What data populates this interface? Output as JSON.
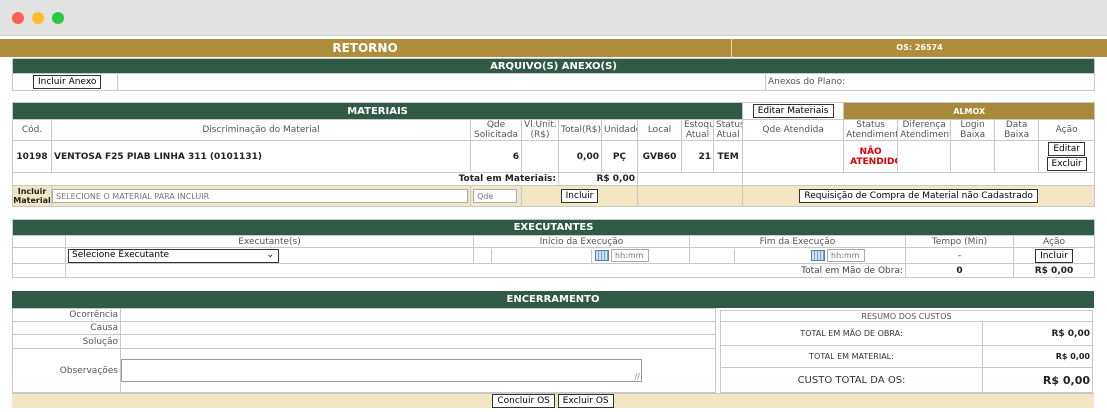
{
  "header": {
    "title": "RETORNO",
    "os": "OS: 26574"
  },
  "anexos": {
    "title": "ARQUIVO(S) ANEXO(S)",
    "add_button": "Incluir Anexo",
    "plan_label": "Anexos do Plano:"
  },
  "materiais": {
    "title": "MATERIAIS",
    "edit_button": "Editar Materiais",
    "almox_title": "ALMOX",
    "columns": [
      "Cód.",
      "Discriminação do Material",
      "Qde Solicitada",
      "Vl.Unit. (R$)",
      "Total(R$)",
      "Unidade",
      "Local",
      "Estoque Atual",
      "Status Atual",
      "Qde Atendida",
      "Status Atendimento",
      "Diferença Atendimento",
      "Login Baixa",
      "Data Baixa",
      "Ação"
    ],
    "row": {
      "code": "10198",
      "description": "VENTOSA F25 PIAB LINHA 311 (0101131)",
      "qty": "6",
      "unit_price": "",
      "total": "0,00",
      "unit": "PÇ",
      "local": "GVB60",
      "stock": "21",
      "status": "TEM",
      "qty_served": "",
      "service_status": "NÃO ATENDIDO",
      "edit_button": "Editar",
      "delete_button": "Excluir"
    },
    "total_label": "Total em Materiais:",
    "total_value": "R$ 0,00",
    "include_label": "Incluir Material",
    "select_placeholder": "SELECIONE O MATERIAL PARA INCLUIR",
    "qty_placeholder": "Qde",
    "include_button": "Incluir",
    "request_button": "Requisição de Compra de Material não Cadastrado"
  },
  "executantes": {
    "title": "EXECUTANTES",
    "columns": [
      "Executante(s)",
      "Início da Execução",
      "Fim da Execução",
      "Tempo (Min)",
      "Ação"
    ],
    "select_value": "Selecione Executante",
    "time_placeholder": "hh:mm",
    "dash": "-",
    "include_button": "Incluir",
    "total_label": "Total em Mão de Obra:",
    "total_minutes": "0",
    "total_value": "R$ 0,00"
  },
  "encerramento": {
    "title": "ENCERRAMENTO",
    "fields": [
      "Ocorrência",
      "Causa",
      "Solução",
      "Observações"
    ],
    "summary_title": "RESUMO DOS CUSTOS",
    "summary": [
      {
        "label": "TOTAL EM MÃO DE OBRA:",
        "value": "R$ 0,00"
      },
      {
        "label": "TOTAL EM MATERIAL:",
        "value": "R$ 0,00"
      },
      {
        "label": "CUSTO TOTAL DA OS:",
        "value": "R$ 0,00"
      }
    ],
    "conclude_button": "Concluir OS",
    "delete_button": "Excluir OS"
  }
}
